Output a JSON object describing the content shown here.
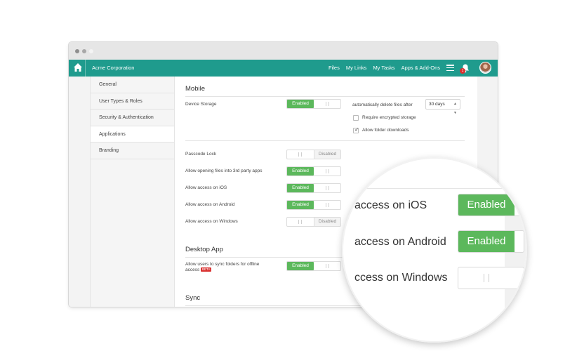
{
  "topbar": {
    "company": "Acme Corporation",
    "nav": [
      "Files",
      "My Links",
      "My Tasks",
      "Apps & Add-Ons"
    ],
    "notification_count": "1",
    "accent_color": "#1f9b8d"
  },
  "sidebar": {
    "items": [
      {
        "label": "General",
        "active": false
      },
      {
        "label": "User Types & Roles",
        "active": false
      },
      {
        "label": "Security & Authentication",
        "active": false
      },
      {
        "label": "Applications",
        "active": true
      },
      {
        "label": "Branding",
        "active": false
      }
    ]
  },
  "mobile": {
    "title": "Mobile",
    "device_storage": {
      "label": "Device Storage",
      "state": "Enabled"
    },
    "auto_delete_label": "automatically delete files after",
    "auto_delete_value": "30 days",
    "require_encrypted": {
      "label": "Require encrypted storage",
      "checked": false
    },
    "allow_folder_downloads": {
      "label": "Allow folder downloads",
      "checked": true
    },
    "passcode_lock": {
      "label": "Passcode Lock",
      "state": "Disabled"
    },
    "third_party": {
      "label": "Allow opening files into 3rd party apps",
      "state": "Enabled"
    },
    "ios": {
      "label": "Allow access on iOS",
      "state": "Enabled"
    },
    "android": {
      "label": "Allow access on Android",
      "state": "Enabled"
    },
    "windows": {
      "label": "Allow access on Windows",
      "state": "Disabled"
    }
  },
  "desktop": {
    "title": "Desktop App",
    "sync_folders": {
      "label_line1": "Allow users to sync folders for offline",
      "label_line2": "access",
      "badge": "BETA",
      "state": "Enabled"
    }
  },
  "sync": {
    "title": "Sync"
  },
  "magnifier": {
    "ios_label": "access on iOS",
    "ios_state": "Enabled",
    "android_label": "access on Android",
    "android_state": "Enabled",
    "windows_label": "ccess on Windows"
  },
  "colors": {
    "enabled_green": "#5cb85c",
    "beta_red": "#d9302f"
  }
}
